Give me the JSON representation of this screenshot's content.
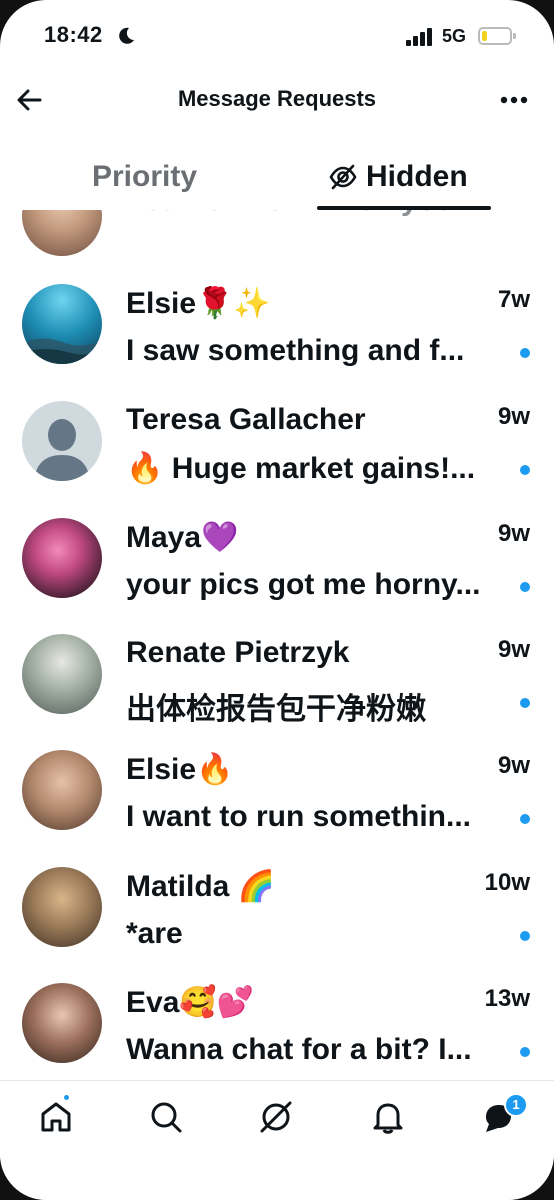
{
  "status_bar": {
    "time": "18:42",
    "network": "5G",
    "battery_level": 0.2
  },
  "header": {
    "title": "Message Requests"
  },
  "tabs": [
    {
      "label": "Priority",
      "active": false
    },
    {
      "label": "Hidden",
      "active": true
    }
  ],
  "conversations": [
    {
      "name": "",
      "time": "",
      "preview": "Let me know when you...",
      "unread": false
    },
    {
      "name": "Elsie🌹✨",
      "time": "7w",
      "preview": "I saw something and f...",
      "unread": true
    },
    {
      "name": "Teresa Gallacher",
      "time": "9w",
      "preview": "🔥 Huge market gains!...",
      "unread": true
    },
    {
      "name": "Maya💜",
      "time": "9w",
      "preview": "your pics got me horny...",
      "unread": true
    },
    {
      "name": "Renate Pietrzyk",
      "time": "9w",
      "preview": "出体检报告包干净粉嫩",
      "unread": true
    },
    {
      "name": "Elsie🔥",
      "time": "9w",
      "preview": "I want to run somethin...",
      "unread": true
    },
    {
      "name": "Matilda 🌈",
      "time": "10w",
      "preview": "*are",
      "unread": true
    },
    {
      "name": "Eva🥰💕",
      "time": "13w",
      "preview": "Wanna chat for a bit? I...",
      "unread": true
    }
  ],
  "tabbar": {
    "items": [
      "home-icon",
      "search-icon",
      "grok-icon",
      "notifications-icon",
      "messages-icon"
    ],
    "messages_badge": "1"
  },
  "colors": {
    "accent": "#1d9bf0",
    "text": "#0f1419",
    "muted": "#6b6f73"
  }
}
